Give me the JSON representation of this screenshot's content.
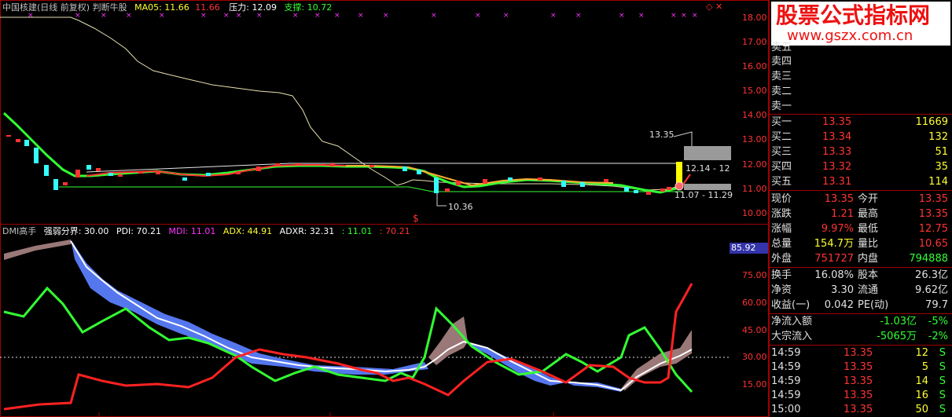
{
  "top": {
    "title": "中国核建(日线 前复权) 判断牛股",
    "ma05_label": "MA05:",
    "ma05_val1": "11.66",
    "ma05_val2": "11.66",
    "pressure_label": "压力:",
    "pressure_val": "12.09",
    "support_label": "支撑:",
    "support_val": "10.72",
    "yaxis": [
      "18.00",
      "17.00",
      "16.00",
      "15.00",
      "14.00",
      "13.00",
      "12.00",
      "11.00",
      "10.00"
    ],
    "annot_high": "13.35",
    "annot_range1": "12.14 - 12",
    "annot_range2": "11.07 - 11.29",
    "annot_low": "10.36",
    "marker": "S"
  },
  "dmi": {
    "title": "DMI高手",
    "strength_label": "强弱分界:",
    "strength_val": "30.00",
    "pdi_label": "PDI:",
    "pdi_val": "70.21",
    "mdi_label": "MDI:",
    "mdi_val": "11.01",
    "adx_label": "ADX:",
    "adx_val": "44.91",
    "adxr_label": "ADXR:",
    "adxr_val": "32.31",
    "extra1": ": 11.01",
    "extra2": ": 70.21",
    "current_val": "85.92",
    "yaxis": [
      "75.00",
      "60.00",
      "45.00",
      "30.00",
      "15.00"
    ]
  },
  "watermark": {
    "line1": "股票公式指标网",
    "line2": "www.gszx.com.cn"
  },
  "orderbook": {
    "sell": [
      {
        "label": "卖五"
      },
      {
        "label": "卖四"
      },
      {
        "label": "卖三"
      },
      {
        "label": "卖二"
      },
      {
        "label": "卖一"
      }
    ],
    "buy": [
      {
        "label": "买一",
        "price": "13.35",
        "vol": "11669"
      },
      {
        "label": "买二",
        "price": "13.34",
        "vol": "132"
      },
      {
        "label": "买三",
        "price": "13.33",
        "vol": "51"
      },
      {
        "label": "买四",
        "price": "13.32",
        "vol": "35"
      },
      {
        "label": "买五",
        "price": "13.31",
        "vol": "114"
      }
    ]
  },
  "quote": {
    "rows": [
      {
        "l1": "现价",
        "v1": "13.35",
        "l2": "今开",
        "v2": "13.35"
      },
      {
        "l1": "涨跌",
        "v1": "1.21",
        "l2": "最高",
        "v2": "13.35"
      },
      {
        "l1": "涨幅",
        "v1": "9.97%",
        "l2": "最低",
        "v2": "12.75"
      },
      {
        "l1": "总量",
        "v1": "154.7万",
        "l2": "量比",
        "v2": "10.65"
      },
      {
        "l1": "外盘",
        "v1": "751727",
        "l2": "内盘",
        "v2": "794888"
      }
    ]
  },
  "fund": {
    "rows": [
      {
        "l1": "换手",
        "v1": "16.08%",
        "l2": "股本",
        "v2": "26.3亿"
      },
      {
        "l1": "净资",
        "v1": "3.30",
        "l2": "流通",
        "v2": "9.62亿"
      },
      {
        "l1": "收益(一)",
        "v1": "0.042",
        "l2": "PE(动)",
        "v2": "79.7"
      }
    ]
  },
  "flow": {
    "rows": [
      {
        "label": "净流入额",
        "val": "-1.03亿",
        "pct": "-5%"
      },
      {
        "label": "大宗流入",
        "val": "-5065万",
        "pct": "-2%"
      }
    ]
  },
  "ticks": [
    {
      "time": "14:59",
      "price": "13.35",
      "vol": "12",
      "side": "S"
    },
    {
      "time": "14:59",
      "price": "13.35",
      "vol": "5",
      "side": "S"
    },
    {
      "time": "14:59",
      "price": "13.35",
      "vol": "14",
      "side": "S"
    },
    {
      "time": "14:59",
      "price": "13.35",
      "vol": "16",
      "side": "S"
    },
    {
      "time": "15:00",
      "price": "13.35",
      "vol": "50",
      "side": "S"
    }
  ],
  "colors": {
    "up": "#ff3333",
    "down": "#33ffff",
    "bg": "#000000",
    "border": "#a00000"
  }
}
